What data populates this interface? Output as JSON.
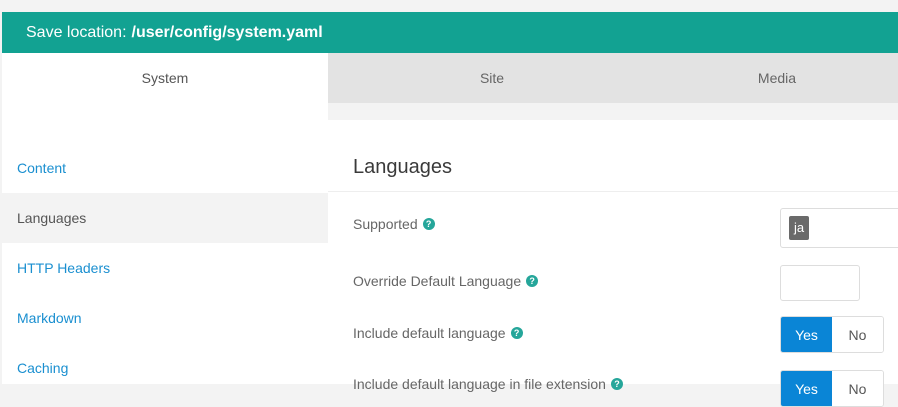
{
  "save_bar": {
    "prefix": "Save location:",
    "path": "/user/config/system.yaml"
  },
  "tabs": [
    {
      "label": "System"
    },
    {
      "label": "Site"
    },
    {
      "label": "Media"
    }
  ],
  "sidebar": {
    "items": [
      {
        "label": "Content"
      },
      {
        "label": "Languages"
      },
      {
        "label": "HTTP Headers"
      },
      {
        "label": "Markdown"
      },
      {
        "label": "Caching"
      }
    ]
  },
  "section": {
    "title": "Languages",
    "fields": {
      "supported": {
        "label": "Supported",
        "tags": [
          "ja"
        ]
      },
      "override_default": {
        "label": "Override Default Language",
        "value": ""
      },
      "include_default": {
        "label": "Include default language",
        "yes": "Yes",
        "no": "No",
        "selected": "Yes"
      },
      "include_default_ext": {
        "label": "Include default language in file extension",
        "yes": "Yes",
        "no": "No",
        "selected": "Yes"
      }
    }
  },
  "icons": {
    "help": "?"
  },
  "colors": {
    "save_bar": "#12a292",
    "link": "#1a8fd0",
    "toggle_selected": "#0a85d6",
    "help_icon": "#25a69a"
  }
}
